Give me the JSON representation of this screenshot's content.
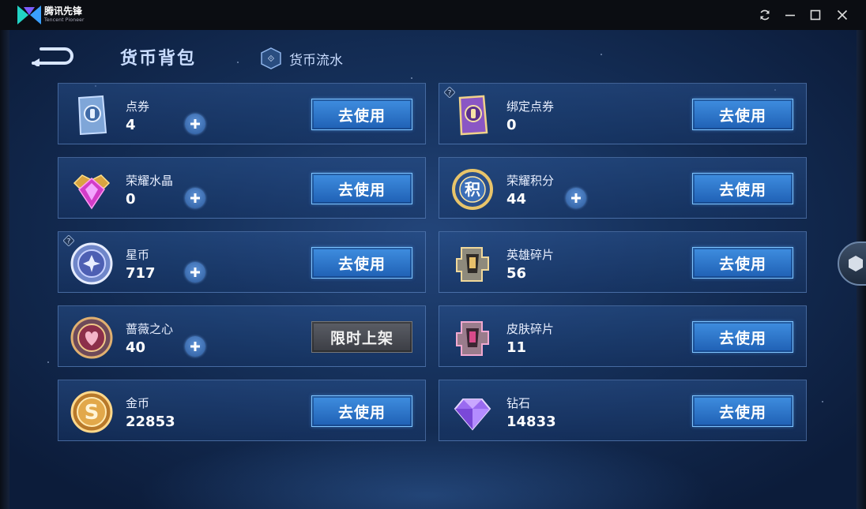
{
  "window": {
    "app_name": "腾讯先锋",
    "app_subtitle": "Tencent Pioneer",
    "controls": [
      "refresh",
      "minimize",
      "maximize",
      "close"
    ]
  },
  "header": {
    "title": "货币背包",
    "flow_link": "货币流水"
  },
  "currencies": [
    {
      "name": "点券",
      "amount": "4",
      "button": "去使用",
      "has_plus": true,
      "icon": "coupon-card-icon"
    },
    {
      "name": "绑定点券",
      "amount": "0",
      "button": "去使用",
      "has_plus": false,
      "icon": "bound-coupon-icon"
    },
    {
      "name": "荣耀水晶",
      "amount": "0",
      "button": "去使用",
      "has_plus": true,
      "icon": "glory-crystal-icon"
    },
    {
      "name": "荣耀积分",
      "amount": "44",
      "button": "去使用",
      "has_plus": true,
      "icon": "glory-points-icon"
    },
    {
      "name": "星币",
      "amount": "717",
      "button": "去使用",
      "has_plus": true,
      "icon": "star-coin-icon"
    },
    {
      "name": "英雄碎片",
      "amount": "56",
      "button": "去使用",
      "has_plus": false,
      "icon": "hero-shard-icon"
    },
    {
      "name": "蔷薇之心",
      "amount": "40",
      "button": "限时上架",
      "has_plus": true,
      "icon": "rose-heart-icon"
    },
    {
      "name": "皮肤碎片",
      "amount": "11",
      "button": "去使用",
      "has_plus": false,
      "icon": "skin-shard-icon"
    },
    {
      "name": "金币",
      "amount": "22853",
      "button": "去使用",
      "has_plus": true,
      "icon": "gold-coin-icon"
    },
    {
      "name": "钻石",
      "amount": "14833",
      "button": "去使用",
      "has_plus": false,
      "icon": "diamond-icon"
    }
  ],
  "colors": {
    "button_blue": "#2f78cc",
    "button_gray": "#4a4d55",
    "title_text": "#c9dcff"
  }
}
